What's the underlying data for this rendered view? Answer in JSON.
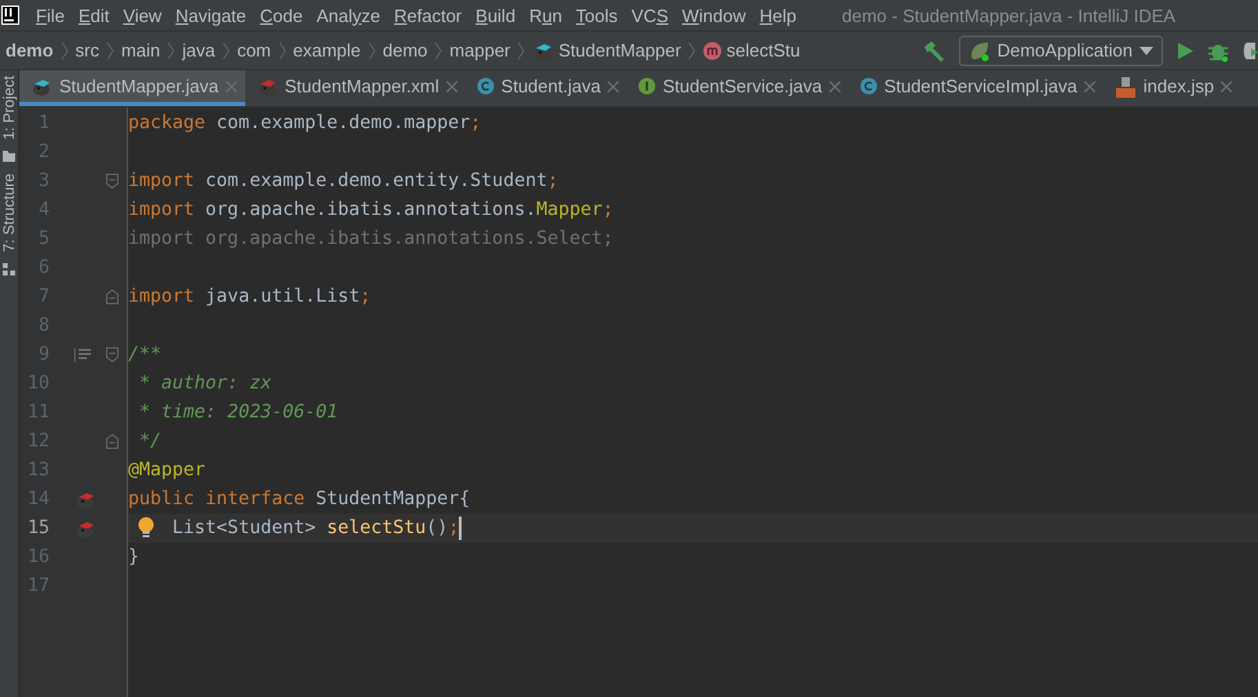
{
  "window": {
    "title": "demo - StudentMapper.java - IntelliJ IDEA"
  },
  "menu": [
    {
      "key": "F",
      "post": "ile"
    },
    {
      "key": "E",
      "post": "dit"
    },
    {
      "key": "V",
      "post": "iew"
    },
    {
      "key": "N",
      "post": "avigate"
    },
    {
      "key": "C",
      "post": "ode"
    },
    {
      "pre": "Anal",
      "key": "y",
      "post": "ze"
    },
    {
      "key": "R",
      "post": "efactor"
    },
    {
      "key": "B",
      "post": "uild"
    },
    {
      "pre": "R",
      "key": "u",
      "post": "n"
    },
    {
      "key": "T",
      "post": "ools"
    },
    {
      "pre": "VC",
      "key": "S"
    },
    {
      "key": "W",
      "post": "indow"
    },
    {
      "key": "H",
      "post": "elp"
    }
  ],
  "breadcrumbs": [
    {
      "label": "demo",
      "kind": "project"
    },
    {
      "label": "src",
      "kind": "folder"
    },
    {
      "label": "main",
      "kind": "folder"
    },
    {
      "label": "java",
      "kind": "folder"
    },
    {
      "label": "com",
      "kind": "folder"
    },
    {
      "label": "example",
      "kind": "folder"
    },
    {
      "label": "demo",
      "kind": "folder"
    },
    {
      "label": "mapper",
      "kind": "folder"
    },
    {
      "label": "StudentMapper",
      "kind": "mapper"
    },
    {
      "label": "selectStu",
      "kind": "method"
    }
  ],
  "run_config": {
    "label": "DemoApplication"
  },
  "tool_windows": [
    {
      "label": "1: Project",
      "kind": "project"
    },
    {
      "label": "7: Structure",
      "kind": "structure"
    }
  ],
  "tabs": [
    {
      "label": "StudentMapper.java",
      "kind": "mapper-java",
      "selected": true
    },
    {
      "label": "StudentMapper.xml",
      "kind": "mapper-xml",
      "selected": false
    },
    {
      "label": "Student.java",
      "kind": "class",
      "selected": false
    },
    {
      "label": "StudentService.java",
      "kind": "interface",
      "selected": false
    },
    {
      "label": "StudentServiceImpl.java",
      "kind": "class",
      "selected": false
    },
    {
      "label": "index.jsp",
      "kind": "jsp",
      "selected": false
    }
  ],
  "lines": [
    {
      "number": "1",
      "current": false,
      "bulb": false,
      "caret": false,
      "tokens": [
        {
          "t": "package ",
          "kind": "kw"
        },
        {
          "t": "com.example.demo.mapper",
          "kind": "text"
        },
        {
          "t": ";",
          "kind": "kw"
        }
      ]
    },
    {
      "number": "2",
      "current": false,
      "bulb": false,
      "caret": false
    },
    {
      "number": "3",
      "current": false,
      "bulb": false,
      "caret": false,
      "gutter": [
        {
          "kind": "fold-start"
        }
      ],
      "tokens": [
        {
          "t": "import ",
          "kind": "kw"
        },
        {
          "t": "com.example.demo.entity.Student",
          "kind": "text"
        },
        {
          "t": ";",
          "kind": "kw"
        }
      ]
    },
    {
      "number": "4",
      "current": false,
      "bulb": false,
      "caret": false,
      "tokens": [
        {
          "t": "import ",
          "kind": "kw"
        },
        {
          "t": "org.apache.ibatis.annotations.",
          "kind": "text"
        },
        {
          "t": "Mapper",
          "kind": "annotation"
        },
        {
          "t": ";",
          "kind": "kw"
        }
      ]
    },
    {
      "number": "5",
      "current": false,
      "bulb": false,
      "caret": false,
      "tokens": [
        {
          "t": "import org.apache.ibatis.annotations.Select;",
          "kind": "unused"
        }
      ]
    },
    {
      "number": "6",
      "current": false,
      "bulb": false,
      "caret": false
    },
    {
      "number": "7",
      "current": false,
      "bulb": false,
      "caret": false,
      "gutter": [
        {
          "kind": "fold-end"
        }
      ],
      "tokens": [
        {
          "t": "import ",
          "kind": "kw"
        },
        {
          "t": "java.util.List",
          "kind": "text"
        },
        {
          "t": ";",
          "kind": "kw"
        }
      ]
    },
    {
      "number": "8",
      "current": false,
      "bulb": false,
      "caret": false
    },
    {
      "number": "9",
      "current": false,
      "bulb": false,
      "caret": false,
      "gutter": [
        {
          "kind": "doc"
        },
        {
          "kind": "fold-start"
        }
      ],
      "tokens": [
        {
          "t": "/**",
          "kind": "doc"
        }
      ]
    },
    {
      "number": "10",
      "current": false,
      "bulb": false,
      "caret": false,
      "tokens": [
        {
          "t": " * author: zx",
          "kind": "doc"
        }
      ]
    },
    {
      "number": "11",
      "current": false,
      "bulb": false,
      "caret": false,
      "tokens": [
        {
          "t": " * time: 2023-06-01",
          "kind": "doc"
        }
      ]
    },
    {
      "number": "12",
      "current": false,
      "bulb": false,
      "caret": false,
      "gutter": [
        {
          "kind": "fold-end"
        }
      ],
      "tokens": [
        {
          "t": " */",
          "kind": "doc"
        }
      ]
    },
    {
      "number": "13",
      "current": false,
      "bulb": false,
      "caret": false,
      "tokens": [
        {
          "t": "@Mapper",
          "kind": "annotation"
        }
      ]
    },
    {
      "number": "14",
      "current": false,
      "bulb": false,
      "caret": false,
      "gutter": [
        {
          "kind": "mapper"
        }
      ],
      "tokens": [
        {
          "t": "public interface ",
          "kind": "kw"
        },
        {
          "t": "StudentMapper{",
          "kind": "text"
        }
      ]
    },
    {
      "number": "15",
      "current": true,
      "bulb": true,
      "caret": true,
      "gutter": [
        {
          "kind": "mapper"
        }
      ],
      "tokens": [
        {
          "t": "    List<Student> ",
          "kind": "text"
        },
        {
          "t": "selectStu",
          "kind": "method"
        },
        {
          "t": "()",
          "kind": "text"
        },
        {
          "t": ";",
          "kind": "kw"
        }
      ]
    },
    {
      "number": "16",
      "current": false,
      "bulb": false,
      "caret": false,
      "tokens": [
        {
          "t": "}",
          "kind": "text"
        }
      ]
    },
    {
      "number": "17",
      "current": false,
      "bulb": false,
      "caret": false
    }
  ]
}
